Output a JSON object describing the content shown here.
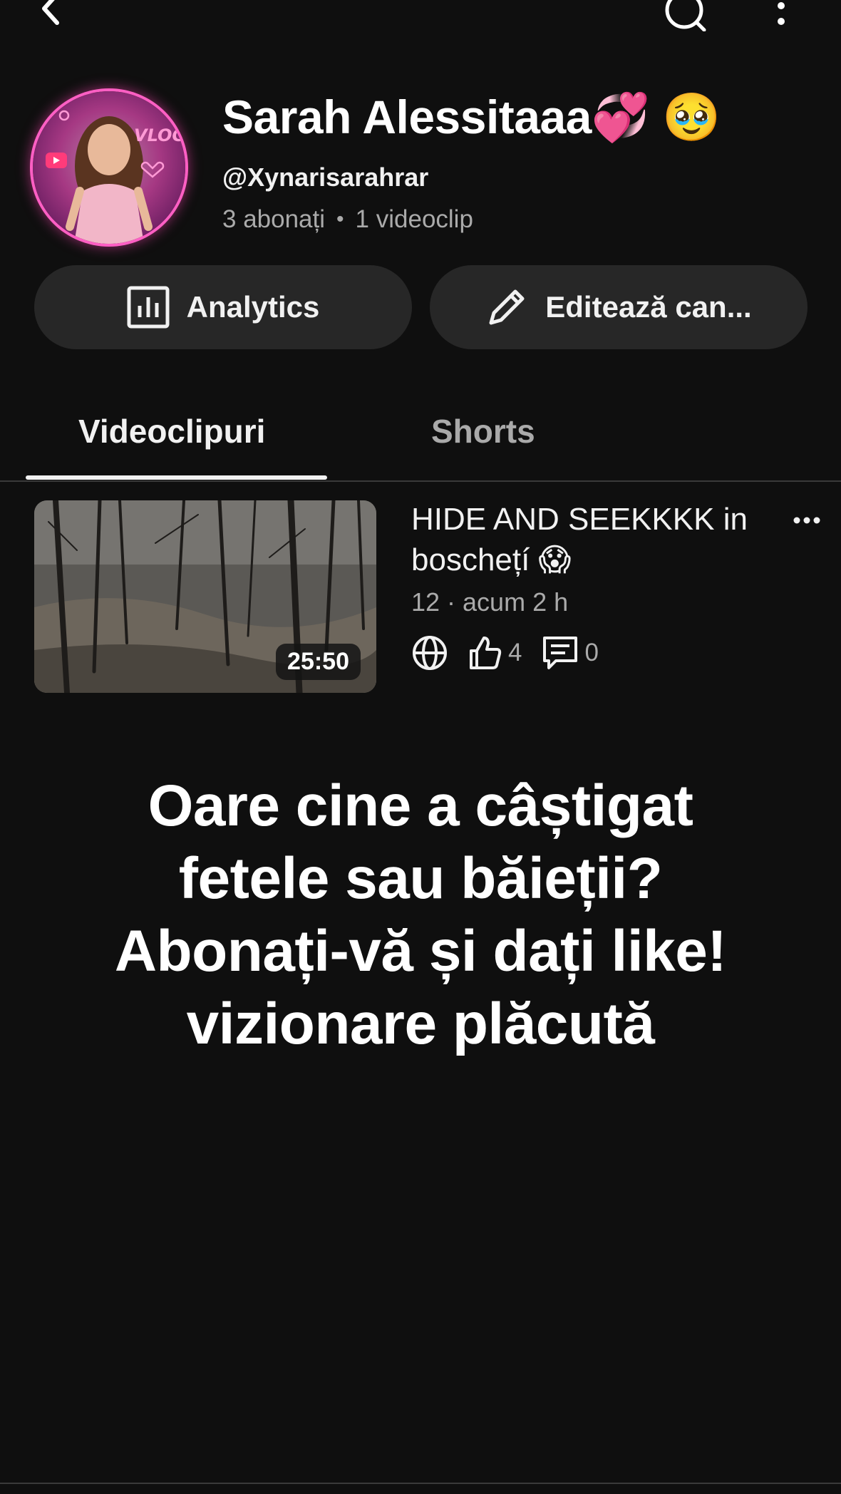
{
  "channel": {
    "name": "Sarah Alessitaaa💞 🥹",
    "handle": "@Xynarisarahrar",
    "subscribers": "3 abonați",
    "separator": "•",
    "video_count": "1 videoclip"
  },
  "actions": {
    "analytics_label": "Analytics",
    "edit_label": "Editează can..."
  },
  "tabs": [
    {
      "label": "Videoclipuri",
      "selected": true
    },
    {
      "label": "Shorts",
      "selected": false
    }
  ],
  "video": {
    "title": "HIDE AND SEEKKKK in boschețí 😱",
    "meta": "12 · acum 2 h",
    "duration": "25:50",
    "likes": "4",
    "comments": "0",
    "visibility_icon": "globe-icon"
  },
  "description": "Oare cine a câștigat\nfetele sau băieții?\nAbonați-vă și dați like!\nvizionare plăcută",
  "colors": {
    "background": "#0f0f0f",
    "button_bg": "#272727",
    "secondary_text": "#aaaaaa",
    "avatar_ring": "#ff5fc4"
  }
}
